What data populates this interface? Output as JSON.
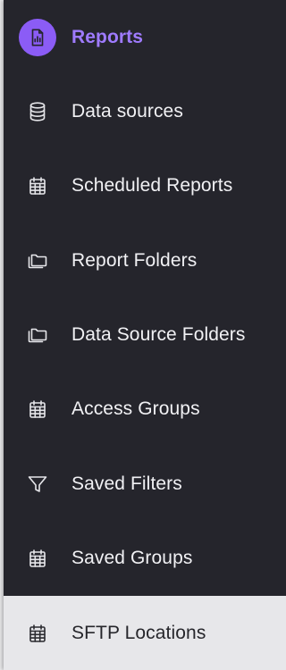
{
  "sidebar": {
    "accent_color": "#8b5cf6",
    "background_color": "#25252c",
    "items": [
      {
        "label": "Reports",
        "icon": "report-chart-icon",
        "active": true
      },
      {
        "label": "Data sources",
        "icon": "database-icon"
      },
      {
        "label": "Scheduled Reports",
        "icon": "calendar-icon"
      },
      {
        "label": "Report Folders",
        "icon": "folders-icon"
      },
      {
        "label": "Data Source Folders",
        "icon": "folders-icon"
      },
      {
        "label": "Access Groups",
        "icon": "calendar-icon"
      },
      {
        "label": "Saved Filters",
        "icon": "filter-icon"
      },
      {
        "label": "Saved Groups",
        "icon": "calendar-icon"
      },
      {
        "label": "SFTP Locations",
        "icon": "calendar-icon",
        "highlighted": true
      }
    ]
  }
}
